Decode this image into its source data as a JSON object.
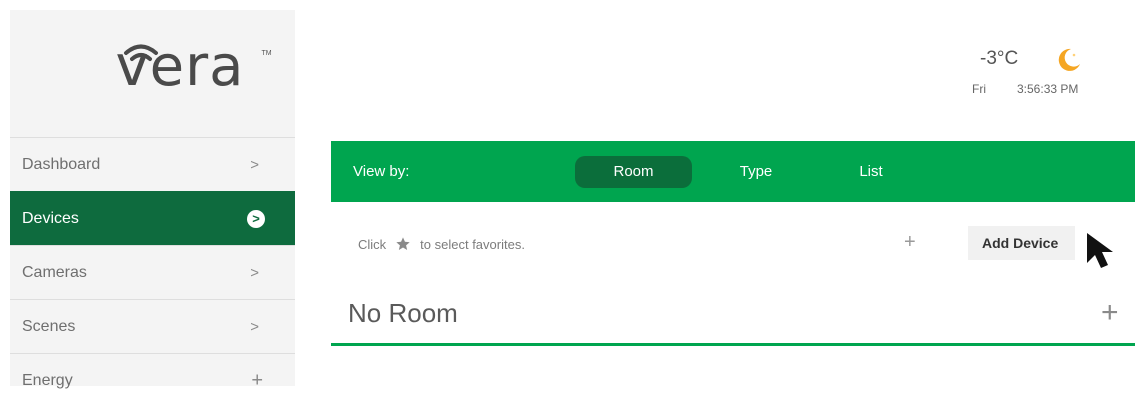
{
  "brand": {
    "logo_text": "vera",
    "tm": "TM"
  },
  "sidebar": {
    "items": [
      {
        "label": "Dashboard",
        "indicator": ">"
      },
      {
        "label": "Devices",
        "indicator": ">"
      },
      {
        "label": "Cameras",
        "indicator": ">"
      },
      {
        "label": "Scenes",
        "indicator": ">"
      },
      {
        "label": "Energy",
        "indicator": "+"
      }
    ],
    "active_index": 1
  },
  "weather": {
    "temperature": "-3°C",
    "icon": "moon-icon",
    "day": "Fri",
    "time": "3:56:33 PM"
  },
  "view_bar": {
    "label": "View by:",
    "tabs": [
      {
        "label": "Room"
      },
      {
        "label": "Type"
      },
      {
        "label": "List"
      }
    ],
    "selected": "Room"
  },
  "favorites_hint": {
    "prefix": "Click",
    "suffix": "to select favorites."
  },
  "add_device": {
    "plus": "+",
    "label": "Add Device"
  },
  "room_section": {
    "title": "No Room",
    "add": "+"
  },
  "colors": {
    "green": "#00a54f",
    "dark_green": "#0e6b3e",
    "sidebar_bg": "#f4f4f4",
    "moon": "#f5a623"
  }
}
